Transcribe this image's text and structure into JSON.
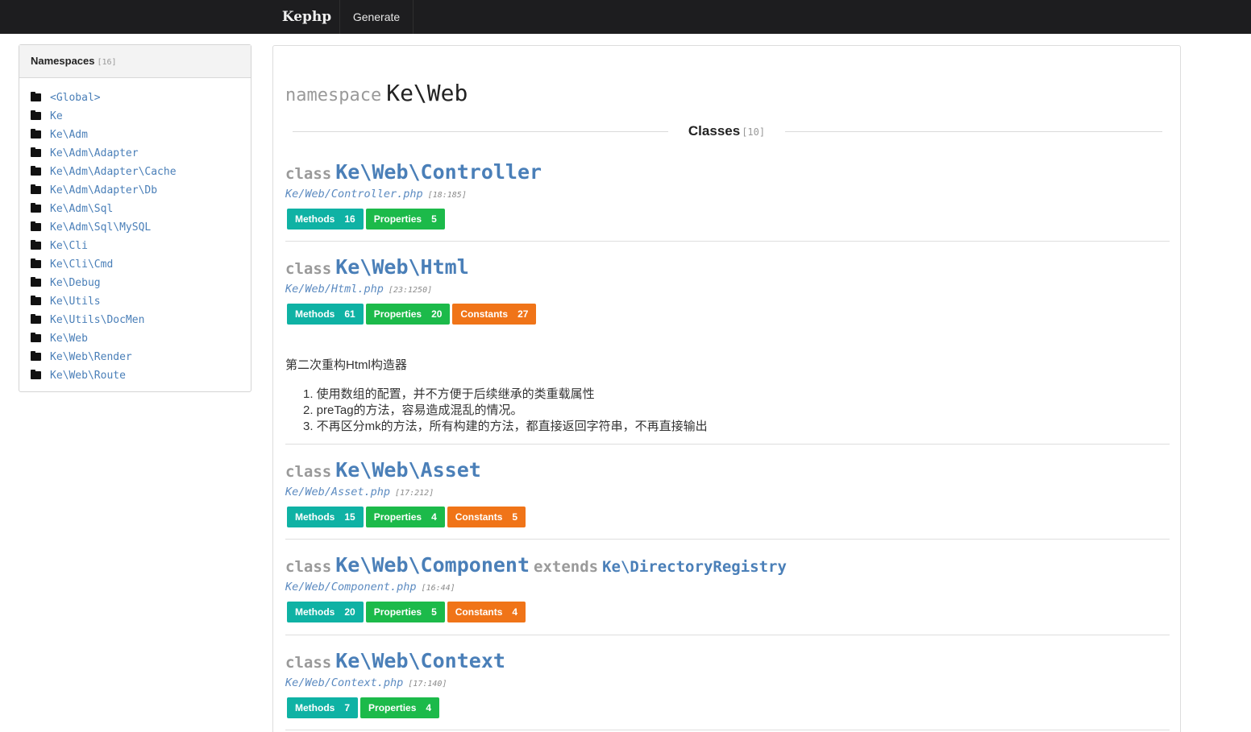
{
  "navbar": {
    "brand": "Kephp",
    "generate": "Generate"
  },
  "sidebar": {
    "title": "Namespaces",
    "count": "[16]",
    "items": [
      "<Global>",
      "Ke",
      "Ke\\Adm",
      "Ke\\Adm\\Adapter",
      "Ke\\Adm\\Adapter\\Cache",
      "Ke\\Adm\\Adapter\\Db",
      "Ke\\Adm\\Sql",
      "Ke\\Adm\\Sql\\MySQL",
      "Ke\\Cli",
      "Ke\\Cli\\Cmd",
      "Ke\\Debug",
      "Ke\\Utils",
      "Ke\\Utils\\DocMen",
      "Ke\\Web",
      "Ke\\Web\\Render",
      "Ke\\Web\\Route"
    ]
  },
  "main": {
    "namespace_kw": "namespace",
    "namespace_name": "Ke\\Web",
    "section_title": "Classes",
    "section_count": "[10]",
    "class_kw": "class",
    "extends_kw": "extends",
    "labels": {
      "methods": "Methods",
      "properties": "Properties",
      "constants": "Constants"
    },
    "classes": [
      {
        "name": "Ke\\Web\\Controller",
        "file": "Ke/Web/Controller.php",
        "lines": "[18:185]",
        "methods": "16",
        "properties": "5"
      },
      {
        "name": "Ke\\Web\\Html",
        "file": "Ke/Web/Html.php",
        "lines": "[23:1250]",
        "methods": "61",
        "properties": "20",
        "constants": "27",
        "description": "第二次重构Html构造器",
        "notes": [
          "1. 使用数组的配置，并不方便于后续继承的类重载属性",
          "2. preTag的方法，容易造成混乱的情况。",
          "3. 不再区分mk的方法，所有构建的方法，都直接返回字符串，不再直接输出"
        ]
      },
      {
        "name": "Ke\\Web\\Asset",
        "file": "Ke/Web/Asset.php",
        "lines": "[17:212]",
        "methods": "15",
        "properties": "4",
        "constants": "5"
      },
      {
        "name": "Ke\\Web\\Component",
        "extends": "Ke\\DirectoryRegistry",
        "file": "Ke/Web/Component.php",
        "lines": "[16:44]",
        "methods": "20",
        "properties": "5",
        "constants": "4"
      },
      {
        "name": "Ke\\Web\\Context",
        "file": "Ke/Web/Context.php",
        "lines": "[17:140]",
        "methods": "7",
        "properties": "4"
      }
    ]
  },
  "colors": {
    "navbar": "#1d1d1f",
    "link": "#4a7fb8",
    "methods": "#0fb2a4",
    "properties": "#1cba4a",
    "constants": "#f07418"
  },
  "icons": {
    "namespace_item": "folder-icon"
  }
}
